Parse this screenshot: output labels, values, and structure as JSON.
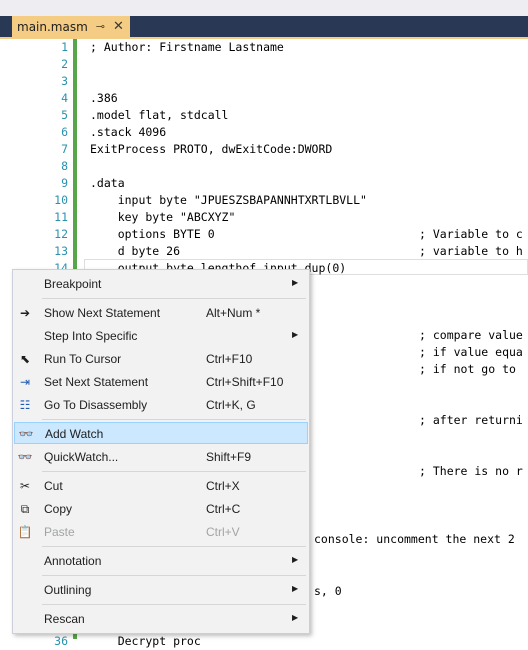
{
  "tab": {
    "title": "main.masm",
    "pin_glyph": "⊸",
    "close_glyph": "✕"
  },
  "lines": [
    {
      "n": "1",
      "code": "; Author: Firstname Lastname",
      "comment": ""
    },
    {
      "n": "2",
      "code": "",
      "comment": ""
    },
    {
      "n": "3",
      "code": "",
      "comment": ""
    },
    {
      "n": "4",
      "code": ".386",
      "comment": ""
    },
    {
      "n": "5",
      "code": ".model flat, stdcall",
      "comment": ""
    },
    {
      "n": "6",
      "code": ".stack 4096",
      "comment": ""
    },
    {
      "n": "7",
      "code": "ExitProcess PROTO, dwExitCode:DWORD",
      "comment": ""
    },
    {
      "n": "8",
      "code": "",
      "comment": ""
    },
    {
      "n": "9",
      "code": ".data",
      "comment": ""
    },
    {
      "n": "10",
      "code": "    input byte \"JPUESZSBAPANNHTXRTLBVLL\"",
      "comment": ""
    },
    {
      "n": "11",
      "code": "    key byte \"ABCXYZ\"",
      "comment": ""
    },
    {
      "n": "12",
      "code": "    options BYTE 0",
      "comment": "; Variable to c"
    },
    {
      "n": "13",
      "code": "    d byte 26",
      "comment": "; variable to h"
    },
    {
      "n": "14",
      "code": "    output byte lengthof input dup(0)",
      "comment": ""
    }
  ],
  "right_fragments": {
    "compare": "; compare value",
    "if_equal": "; if value equa",
    "if_not": "; if not go to",
    "after": "; after returni",
    "no": "; There is no r",
    "console": "console: uncomment the next 2",
    "s0": "s, 0"
  },
  "last_line": {
    "n": "36",
    "code": "    Decrypt proc"
  },
  "context_menu": {
    "items": [
      {
        "label": "Breakpoint",
        "shortcut": "",
        "icon": "",
        "submenu": true,
        "disabled": false
      },
      {
        "label": "Show Next Statement",
        "shortcut": "Alt+Num *",
        "icon": "arrow-right-icon",
        "submenu": false,
        "disabled": false
      },
      {
        "label": "Step Into Specific",
        "shortcut": "",
        "icon": "",
        "submenu": true,
        "disabled": false
      },
      {
        "label": "Run To Cursor",
        "shortcut": "Ctrl+F10",
        "icon": "run-to-cursor-icon",
        "submenu": false,
        "disabled": false
      },
      {
        "label": "Set Next Statement",
        "shortcut": "Ctrl+Shift+F10",
        "icon": "set-next-statement-icon",
        "submenu": false,
        "disabled": false
      },
      {
        "label": "Go To Disassembly",
        "shortcut": "Ctrl+K, G",
        "icon": "disassembly-icon",
        "submenu": false,
        "disabled": false
      },
      {
        "label": "Add Watch",
        "shortcut": "",
        "icon": "watch-glasses-icon",
        "submenu": false,
        "disabled": false
      },
      {
        "label": "QuickWatch...",
        "shortcut": "Shift+F9",
        "icon": "quickwatch-glasses-icon",
        "submenu": false,
        "disabled": false
      },
      {
        "label": "Cut",
        "shortcut": "Ctrl+X",
        "icon": "scissors-icon",
        "submenu": false,
        "disabled": false
      },
      {
        "label": "Copy",
        "shortcut": "Ctrl+C",
        "icon": "copy-icon",
        "submenu": false,
        "disabled": false
      },
      {
        "label": "Paste",
        "shortcut": "Ctrl+V",
        "icon": "paste-icon",
        "submenu": false,
        "disabled": true
      },
      {
        "label": "Annotation",
        "shortcut": "",
        "icon": "",
        "submenu": true,
        "disabled": false
      },
      {
        "label": "Outlining",
        "shortcut": "",
        "icon": "",
        "submenu": true,
        "disabled": false
      },
      {
        "label": "Rescan",
        "shortcut": "",
        "icon": "",
        "submenu": true,
        "disabled": false
      }
    ],
    "highlighted": "Add Watch"
  },
  "colors": {
    "tab_active": "#f5cc84",
    "tab_strip": "#293955",
    "line_number": "#2b91af",
    "change_bar": "#57a64a",
    "menu_bg": "#f2f2f2",
    "menu_highlight": "#cce8ff"
  }
}
